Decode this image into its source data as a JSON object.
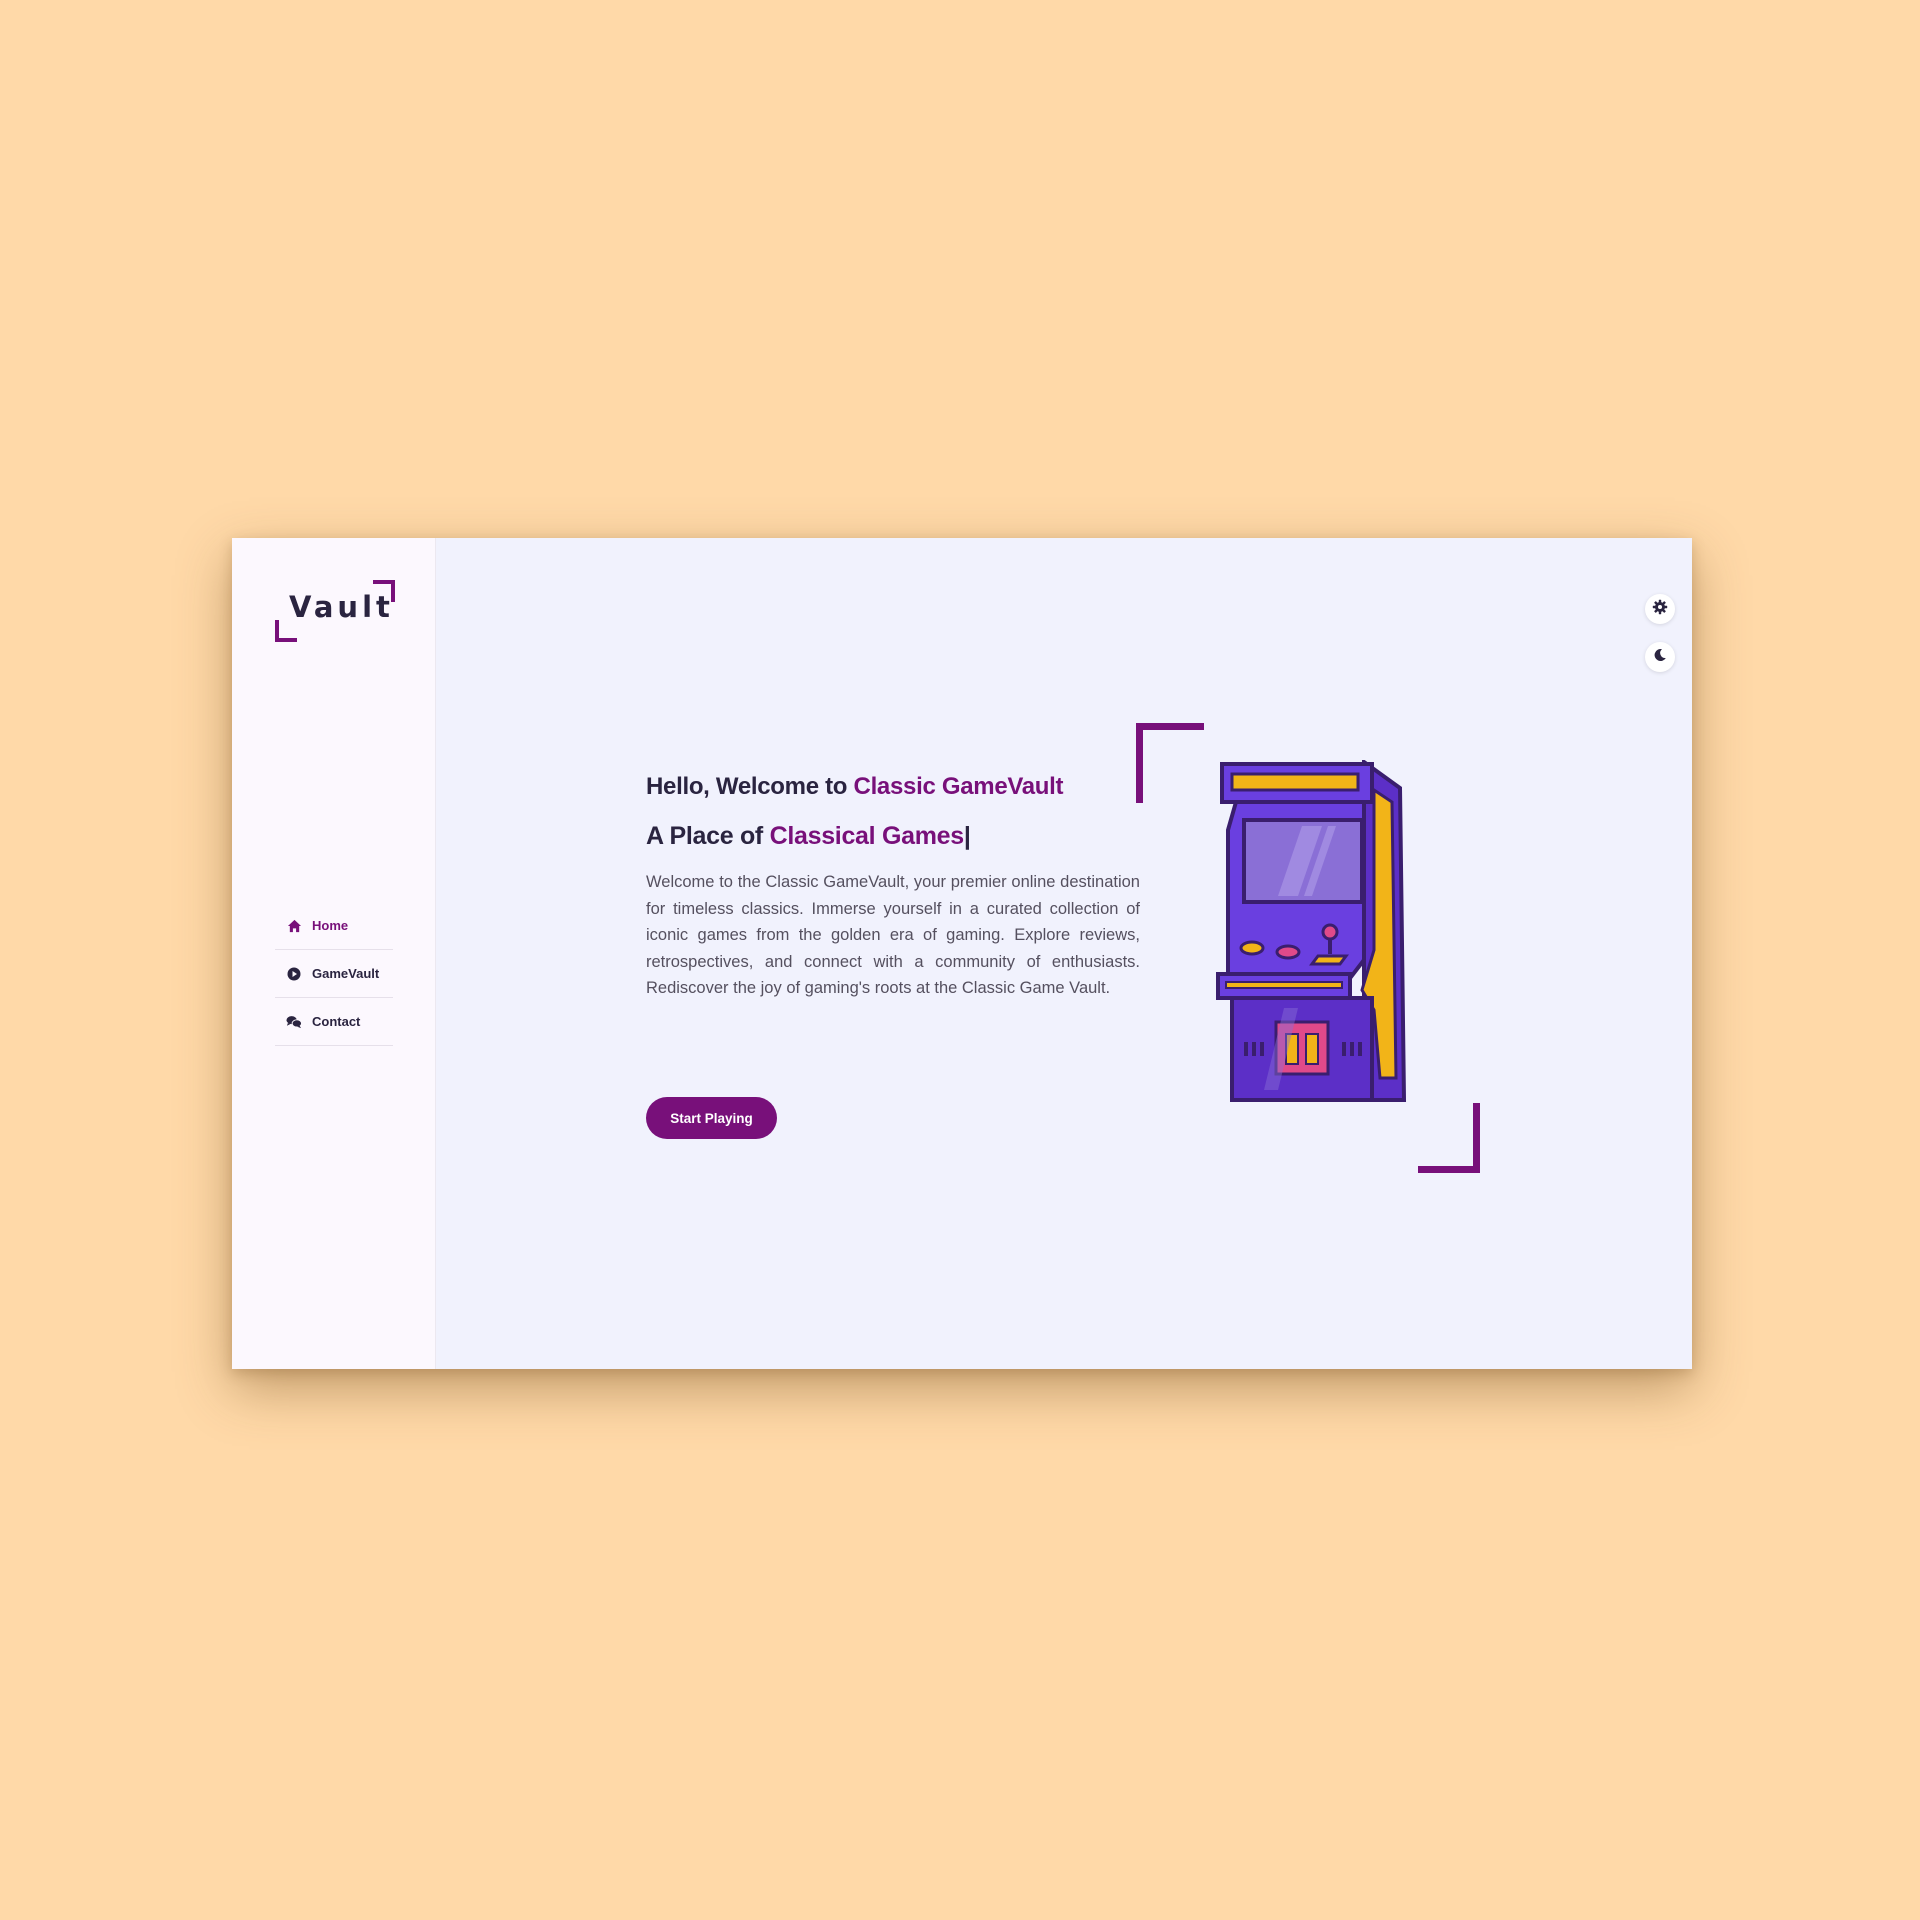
{
  "logo": {
    "text": "Vault"
  },
  "nav": {
    "items": [
      {
        "label": "Home",
        "icon": "home-icon",
        "active": true
      },
      {
        "label": "GameVault",
        "icon": "play-circle-icon",
        "active": false
      },
      {
        "label": "Contact",
        "icon": "chat-bubbles-icon",
        "active": false
      }
    ]
  },
  "controls": {
    "settings_icon": "gear-icon",
    "theme_icon": "moon-icon"
  },
  "hero": {
    "greeting_prefix": "Hello, Welcome to ",
    "greeting_highlight": "Classic GameVault",
    "tagline_prefix": "A Place of ",
    "tagline_highlight": "Classical Games",
    "cursor": "|",
    "description": "Welcome to the Classic GameVault, your premier online destination for timeless classics. Immerse yourself in a curated collection of iconic games from the golden era of gaming. Explore reviews, retrospectives, and connect with a community of enthusiasts. Rediscover the joy of gaming's roots at the Classic Game Vault.",
    "cta_label": "Start Playing",
    "illustration_icon": "arcade-cabinet-icon"
  },
  "colors": {
    "accent": "#78107a",
    "page_background": "#ffd9a8",
    "content_background": "#f1f2fd",
    "sidebar_background": "#fcf8fe",
    "text_dark": "#2a2440"
  }
}
